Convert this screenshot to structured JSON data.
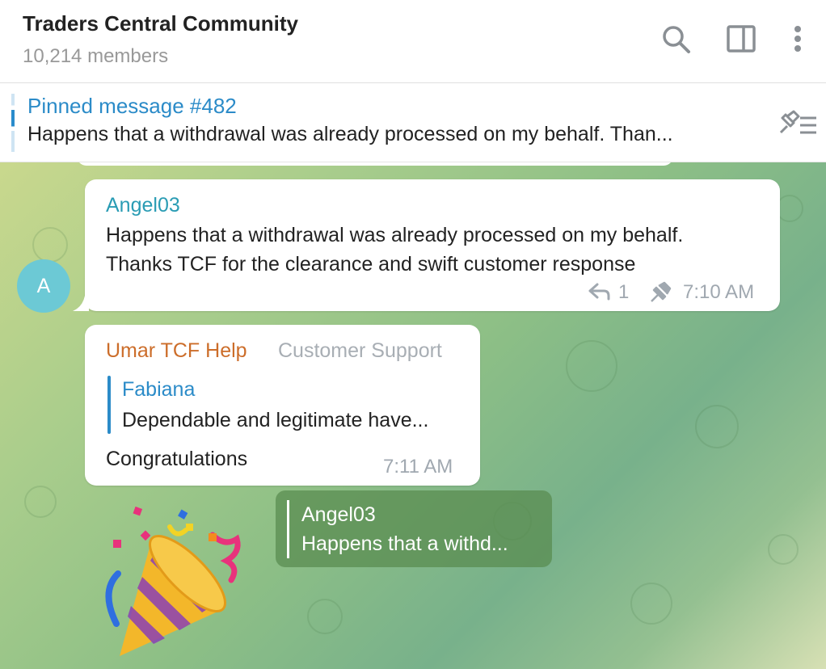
{
  "header": {
    "title": "Traders Central Community",
    "members": "10,214 members"
  },
  "pinned": {
    "title": "Pinned message #482",
    "text": "Happens that a withdrawal was already processed on my behalf. Than..."
  },
  "messages": [
    {
      "avatar_letter": "A",
      "sender": "Angel03",
      "sender_color": "#2a9cb4",
      "lines": [
        "Happens that a withdrawal was already processed on my behalf.",
        "Thanks TCF for the clearance and swift customer response"
      ],
      "reply_count": "1",
      "time": "7:10 AM"
    },
    {
      "sender": "Umar TCF Help",
      "sender_color": "#cc6d2a",
      "role": "Customer Support",
      "quote_name": "Fabiana",
      "quote_text": "Dependable and legitimate have...",
      "text": "Congratulations",
      "time": "7:11 AM"
    }
  ],
  "reply_preview": {
    "name": "Angel03",
    "text": "Happens that a withd..."
  },
  "colors": {
    "accent": "#2b8bc8"
  }
}
